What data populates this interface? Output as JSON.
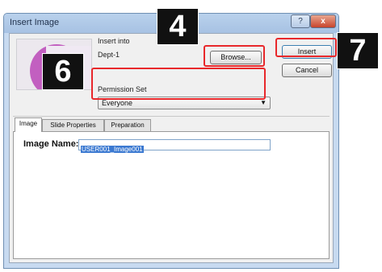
{
  "window": {
    "title": "Insert Image",
    "help_glyph": "?",
    "close_glyph": "x"
  },
  "insert_into": {
    "label": "Insert into",
    "value": "Dept-1"
  },
  "permission_set": {
    "label": "Permission Set",
    "value": "Everyone"
  },
  "buttons": {
    "browse": "Browse...",
    "insert": "Insert",
    "cancel": "Cancel"
  },
  "tabs": [
    "Image",
    "Slide Properties",
    "Preparation"
  ],
  "image_name": {
    "label": "Image Name:",
    "value": "USER001_Image001"
  },
  "callouts": {
    "browse": "4",
    "permission": "6",
    "insert": "7"
  },
  "colors": {
    "highlight": "#e8282b",
    "callout_bg": "#111111",
    "selection": "#3b79d1"
  }
}
